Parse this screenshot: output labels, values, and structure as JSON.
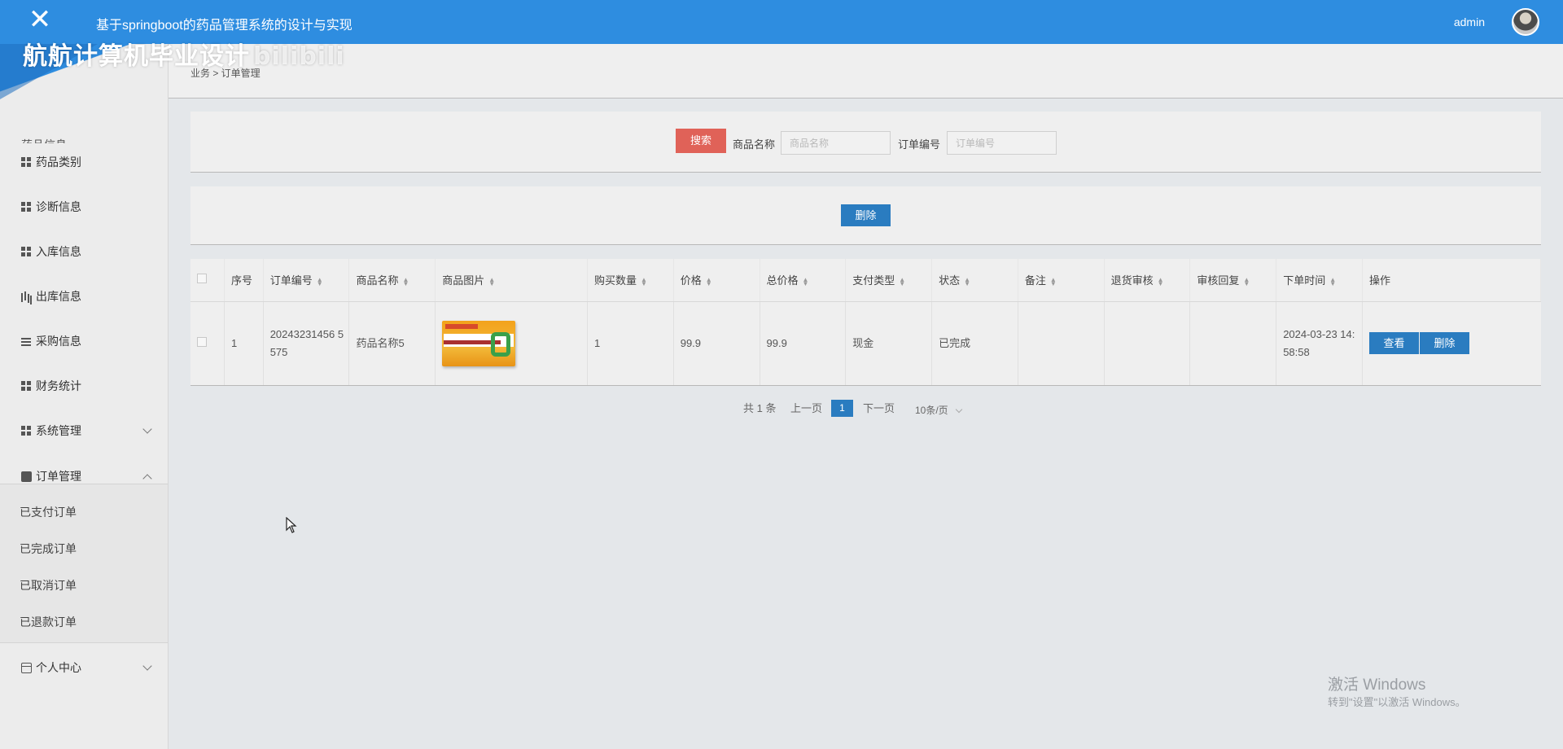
{
  "topbar": {
    "title": "基于springboot的药品管理系统的设计与实现",
    "user": "admin",
    "close_glyph": "✕"
  },
  "watermark": {
    "text": "航航计算机毕业设计",
    "logo": "bilibili"
  },
  "sidebar": {
    "cut_item": "药品信息",
    "items": [
      {
        "label": "药品类别",
        "icon": "grid-icon"
      },
      {
        "label": "诊断信息",
        "icon": "grid-icon"
      },
      {
        "label": "入库信息",
        "icon": "grid-icon"
      },
      {
        "label": "出库信息",
        "icon": "bar-chart-icon"
      },
      {
        "label": "采购信息",
        "icon": "list-icon"
      },
      {
        "label": "财务统计",
        "icon": "grid-icon"
      },
      {
        "label": "系统管理",
        "icon": "grid-icon"
      },
      {
        "label": "订单管理",
        "icon": "order-icon"
      },
      {
        "label": "个人中心",
        "icon": "card-icon"
      }
    ],
    "order_submenu": [
      "已支付订单",
      "已完成订单",
      "已取消订单",
      "已退款订单"
    ]
  },
  "breadcrumb": "业务 > 订单管理",
  "search": {
    "button": "搜索",
    "product_label": "商品名称",
    "product_placeholder": "商品名称",
    "order_label": "订单编号",
    "order_placeholder": "订单编号"
  },
  "actions": {
    "delete": "删除"
  },
  "table": {
    "headers": [
      "序号",
      "订单编号",
      "商品名称",
      "商品图片",
      "购买数量",
      "价格",
      "总价格",
      "支付类型",
      "状态",
      "备注",
      "退货审核",
      "审核回复",
      "下单时间",
      "操作"
    ],
    "rows": [
      {
        "index": "1",
        "order_no": "20243231456 5575",
        "product": "药品名称5",
        "qty": "1",
        "price": "99.9",
        "total": "99.9",
        "pay_type": "现金",
        "status": "已完成",
        "remark": "",
        "return_audit": "",
        "audit_reply": "",
        "time": "2024-03-23 14:58:58",
        "view_label": "查看",
        "delete_label": "删除"
      }
    ]
  },
  "pagination": {
    "total": "共 1 条",
    "prev": "上一页",
    "page": "1",
    "next": "下一页",
    "size": "10条/页"
  },
  "windows_activation": {
    "line1": "激活 Windows",
    "line2": "转到\"设置\"以激活 Windows。"
  },
  "colors": {
    "topbar": "#2e8de0",
    "primary_button": "#2a7cc0",
    "search_button": "#e06258",
    "background": "#e4e7ea"
  }
}
